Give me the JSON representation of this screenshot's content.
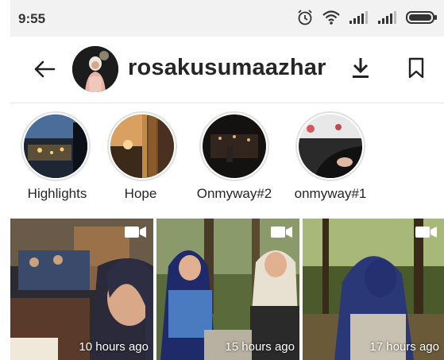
{
  "status_bar": {
    "time": "9:55",
    "icons": [
      "alarm-icon",
      "wifi-icon",
      "signal-icon",
      "signal-icon",
      "battery-icon"
    ]
  },
  "header": {
    "username": "rosakusumaazhar",
    "back_icon": "arrow-left-icon",
    "download_icon": "download-icon",
    "bookmark_icon": "bookmark-icon"
  },
  "highlights": [
    {
      "label": "Highlights"
    },
    {
      "label": "Hope"
    },
    {
      "label": "Onmyway#2"
    },
    {
      "label": "onmyway#1"
    }
  ],
  "grid": [
    {
      "time": "10 hours ago",
      "type": "video"
    },
    {
      "time": "15 hours ago",
      "type": "video"
    },
    {
      "time": "17 hours ago",
      "type": "video"
    }
  ],
  "colors": {
    "status_bg": "#f2f2f2",
    "text": "#262626",
    "ring": "#e0e0e0"
  }
}
